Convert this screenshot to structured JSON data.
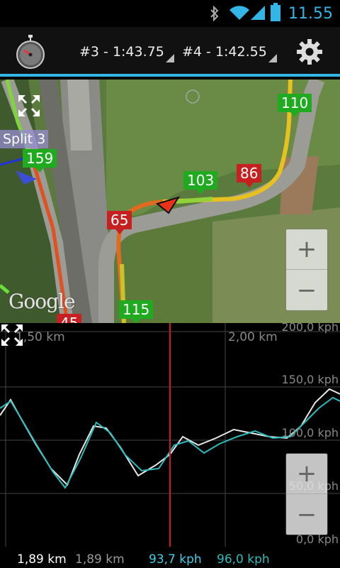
{
  "status_bar": {
    "time": "11.55",
    "icons": [
      "bluetooth-icon",
      "wifi-icon",
      "signal-icon",
      "battery-icon"
    ]
  },
  "action_bar": {
    "lap_a": "#3 - 1:43.75",
    "lap_b": "#4 - 1:42.55",
    "icons": [
      "stopwatch-icon",
      "settings-gear-icon"
    ]
  },
  "map": {
    "split_label": "Split 3",
    "markers": [
      {
        "text": "159",
        "color": "green"
      },
      {
        "text": "110",
        "color": "green"
      },
      {
        "text": "103",
        "color": "green"
      },
      {
        "text": "86",
        "color": "red"
      },
      {
        "text": "65",
        "color": "red"
      },
      {
        "text": "115",
        "color": "green"
      },
      {
        "text": "45",
        "color": "red"
      }
    ],
    "zoom_in": "+",
    "zoom_out": "−",
    "logo": "Google"
  },
  "graph": {
    "x_labels": [
      "1,50 km",
      "2,00 km"
    ],
    "y_labels": [
      "200,0 kph",
      "150,0 kph",
      "100,0 kph",
      "50,0 kph",
      "0,0 kph"
    ],
    "zoom_in": "+",
    "zoom_out": "−"
  },
  "readout": {
    "dist_a": "1,89 km",
    "dist_b": "1,89 km",
    "speed_a": "93,7 kph",
    "speed_b": "96,0 kph"
  },
  "colors": {
    "accent": "#33b5e5",
    "line_white": "#e6e6e6",
    "line_cyan": "#2bbcbc",
    "cursor": "#d01818"
  }
}
